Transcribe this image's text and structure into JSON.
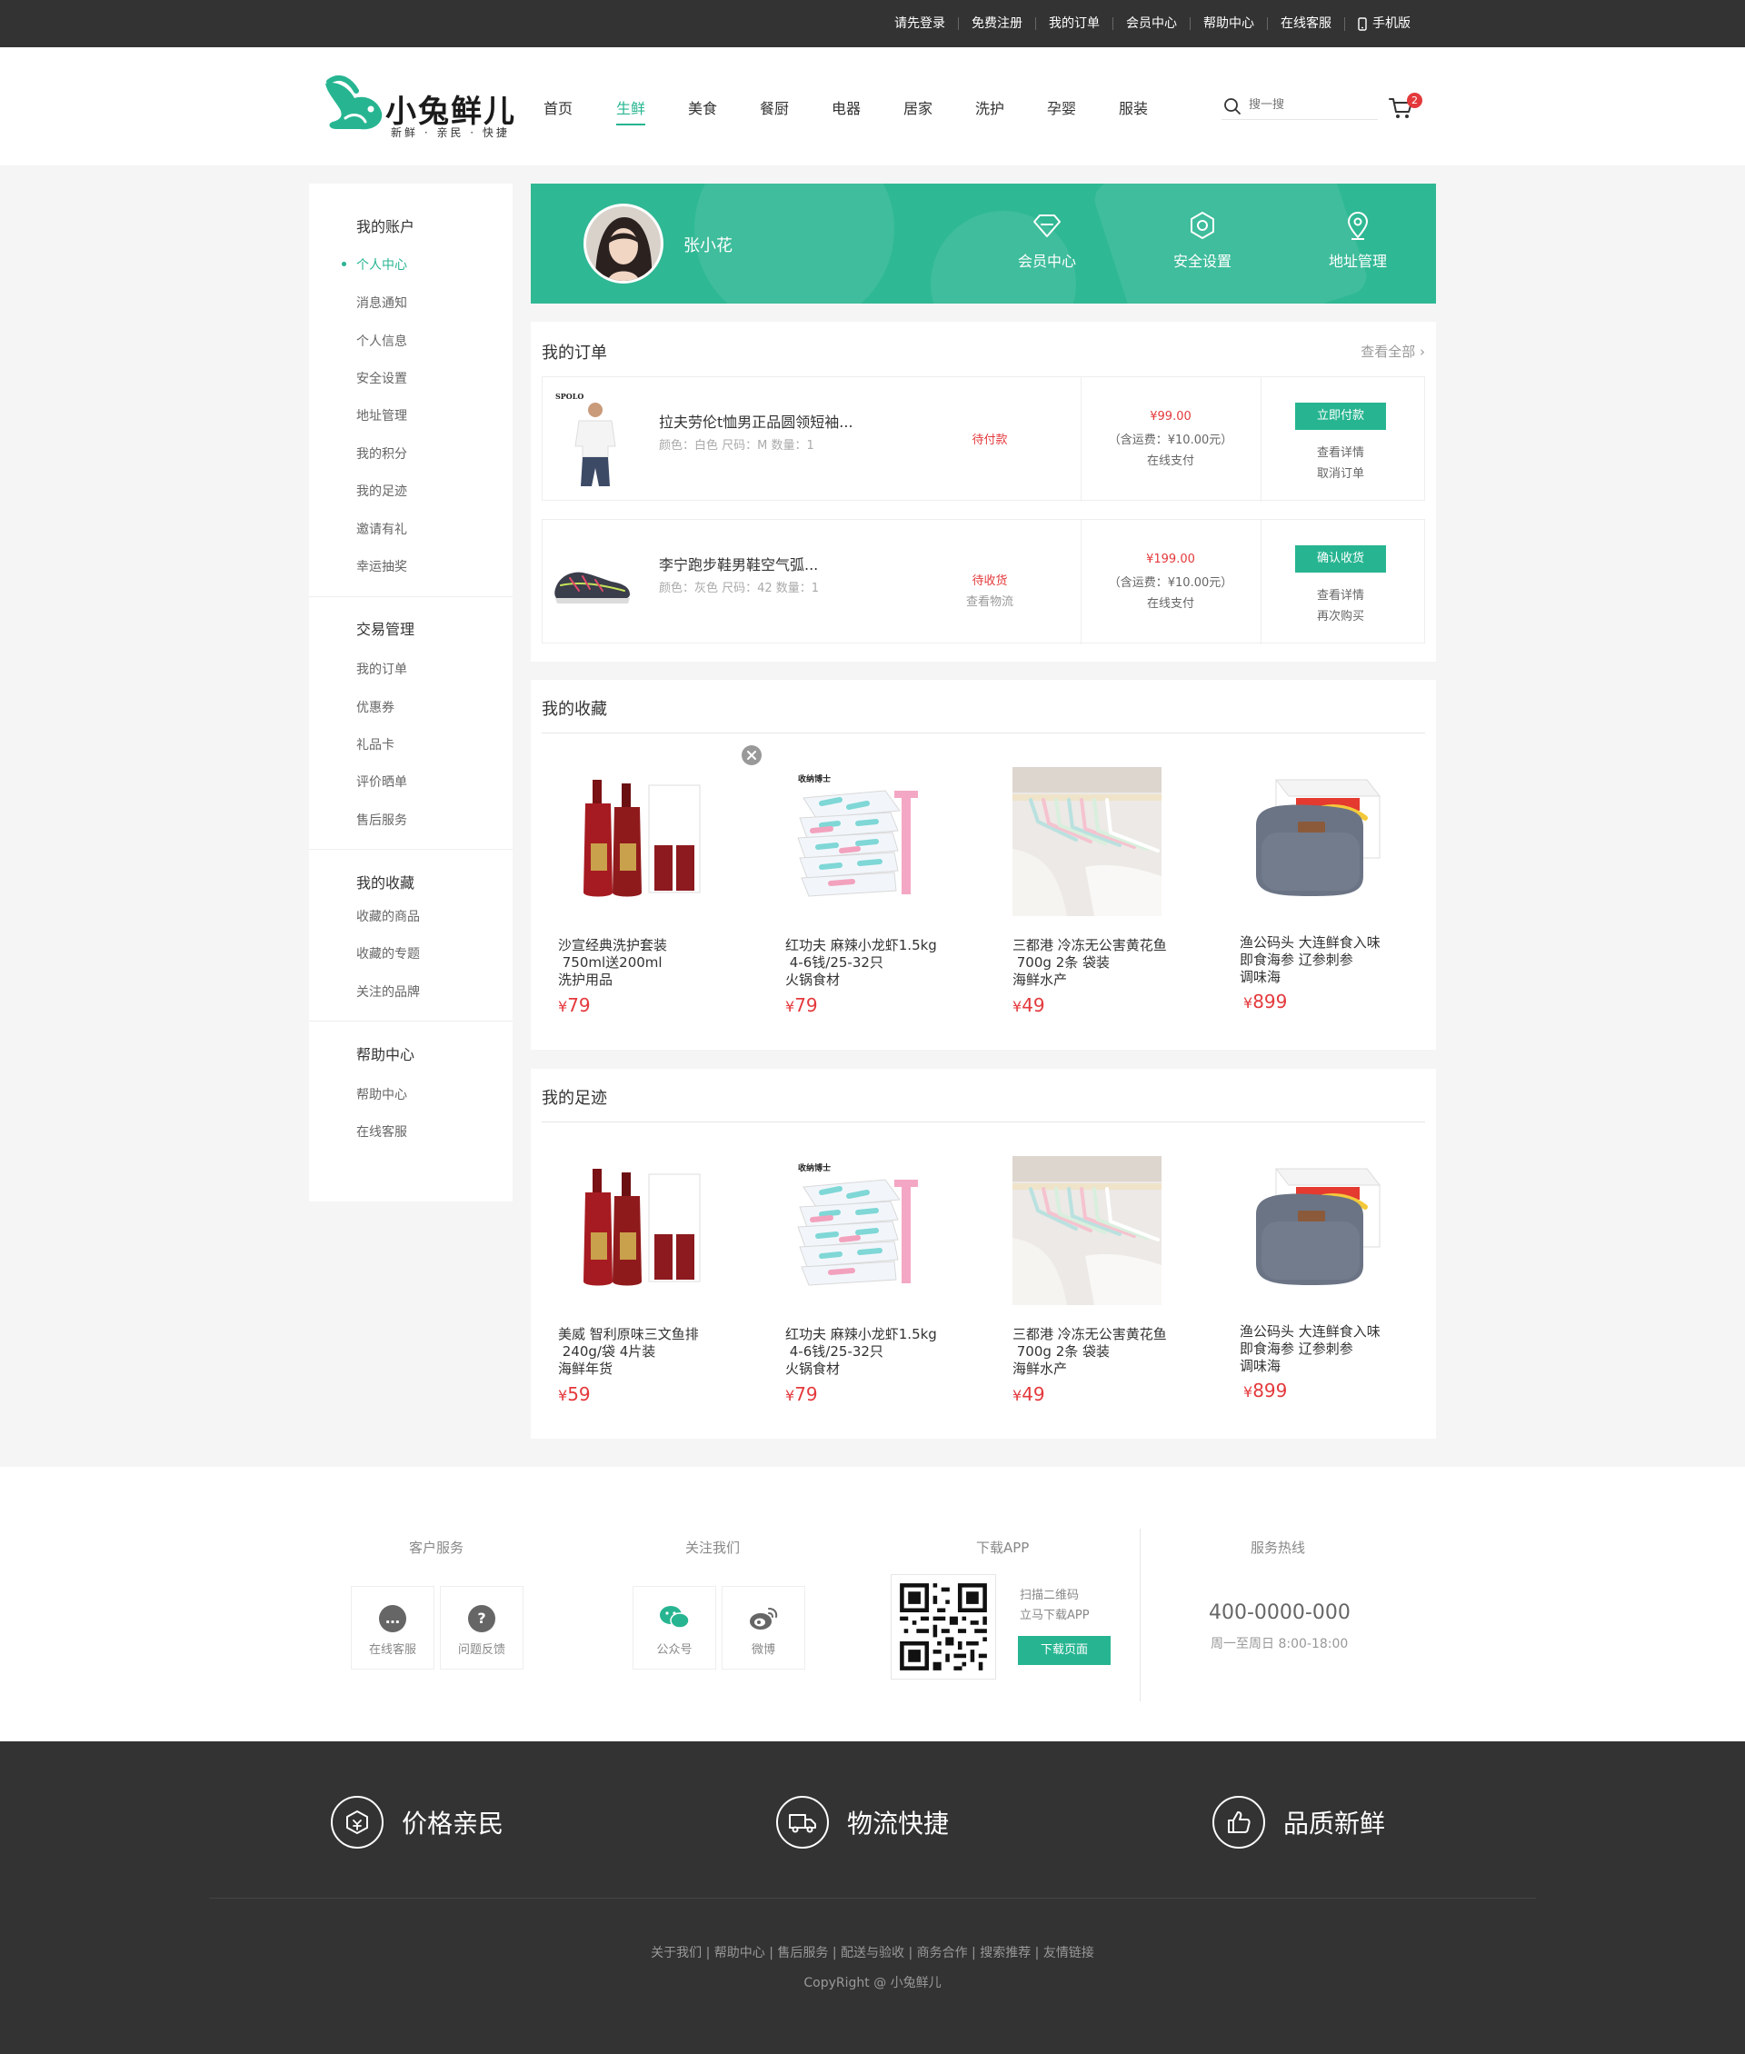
{
  "topbar": {
    "links": [
      "请先登录",
      "免费注册",
      "我的订单",
      "会员中心",
      "帮助中心",
      "在线客服",
      "手机版"
    ]
  },
  "header": {
    "logo_text": "小兔鲜儿",
    "logo_sub": "新鲜 · 亲民 · 快捷",
    "nav": [
      "首页",
      "生鲜",
      "美食",
      "餐厨",
      "电器",
      "居家",
      "洗护",
      "孕婴",
      "服装"
    ],
    "nav_active": "生鲜",
    "search_placeholder": "搜一搜",
    "cart_count": "2"
  },
  "sidebar": {
    "sections": [
      {
        "title": "我的账户",
        "items": [
          "个人中心",
          "消息通知",
          "个人信息",
          "安全设置",
          "地址管理",
          "我的积分",
          "我的足迹",
          "邀请有礼",
          "幸运抽奖"
        ]
      },
      {
        "title": "交易管理",
        "items": [
          "我的订单",
          "优惠券",
          "礼品卡",
          "评价晒单",
          "售后服务"
        ]
      },
      {
        "title": "我的收藏",
        "items": [
          "收藏的商品",
          "收藏的专题",
          "关注的品牌"
        ]
      },
      {
        "title": "帮助中心",
        "items": [
          "帮助中心",
          "在线客服"
        ]
      }
    ],
    "active": "个人中心"
  },
  "profile": {
    "username": "张小花",
    "links": [
      "会员中心",
      "安全设置",
      "地址管理"
    ]
  },
  "orders": {
    "title": "我的订单",
    "view_all": "查看全部",
    "items": [
      {
        "name": "拉夫劳伦t恤男正品圆领短袖...",
        "spec": "颜色：白色   尺码：M   数量：1",
        "status": "待付款",
        "status_sub": "",
        "price": "¥99.00",
        "fee": "（含运费：¥10.00元）",
        "pay": "在线支付",
        "button": "立即付款",
        "links": [
          "查看详情",
          "取消订单"
        ]
      },
      {
        "name": "李宁跑步鞋男鞋空气弧...",
        "spec": "颜色：灰色   尺码：42   数量：1",
        "status": "待收货",
        "status_sub": "查看物流",
        "price": "¥199.00",
        "fee": "（含运费：¥10.00元）",
        "pay": "在线支付",
        "button": "确认收货",
        "links": [
          "查看详情",
          "再次购买"
        ]
      }
    ]
  },
  "favorites": {
    "title": "我的收藏",
    "items": [
      {
        "name": "沙宣经典洗护套装\n 750ml送200ml\n洗护用品",
        "price": "79"
      },
      {
        "name": "红功夫 麻辣小龙虾1.5kg\n 4-6钱/25-32只\n火锅食材",
        "price": "79"
      },
      {
        "name": "三都港 冷冻无公害黄花鱼\n 700g 2条 袋装\n海鲜水产",
        "price": "49"
      },
      {
        "name": "渔公码头 大连鲜食入味\n即食海参 辽参刺参\n调味海",
        "price": "899"
      }
    ]
  },
  "footprints": {
    "title": "我的足迹",
    "items": [
      {
        "name": "美威 智利原味三文鱼排\n 240g/袋 4片装\n海鲜年货",
        "price": "59"
      },
      {
        "name": "红功夫 麻辣小龙虾1.5kg\n 4-6钱/25-32只\n火锅食材",
        "price": "79"
      },
      {
        "name": "三都港 冷冻无公害黄花鱼\n 700g 2条 袋装\n海鲜水产",
        "price": "49"
      },
      {
        "name": "渔公码头 大连鲜食入味\n即食海参 辽参刺参\n调味海",
        "price": "899"
      }
    ]
  },
  "currency": "¥",
  "footer": {
    "service_title": "客户服务",
    "service": [
      "在线客服",
      "问题反馈"
    ],
    "follow_title": "关注我们",
    "follow": [
      "公众号",
      "微博"
    ],
    "app_title": "下载APP",
    "app_text1": "扫描二维码",
    "app_text2": "立马下载APP",
    "app_button": "下载页面",
    "hotline_title": "服务热线",
    "hotline": "400-0000-000",
    "hours": "周一至周日 8:00-18:00",
    "features": [
      "价格亲民",
      "物流快捷",
      "品质新鲜"
    ],
    "links": "关于我们  |  帮助中心  |  售后服务  |  配送与验收  |  商务合作  |  搜索推荐  |  友情链接",
    "copyright": "CopyRight @ 小兔鲜儿"
  },
  "colors": {
    "brand": "#27b591",
    "price": "#e4393c",
    "dark": "#333333"
  }
}
